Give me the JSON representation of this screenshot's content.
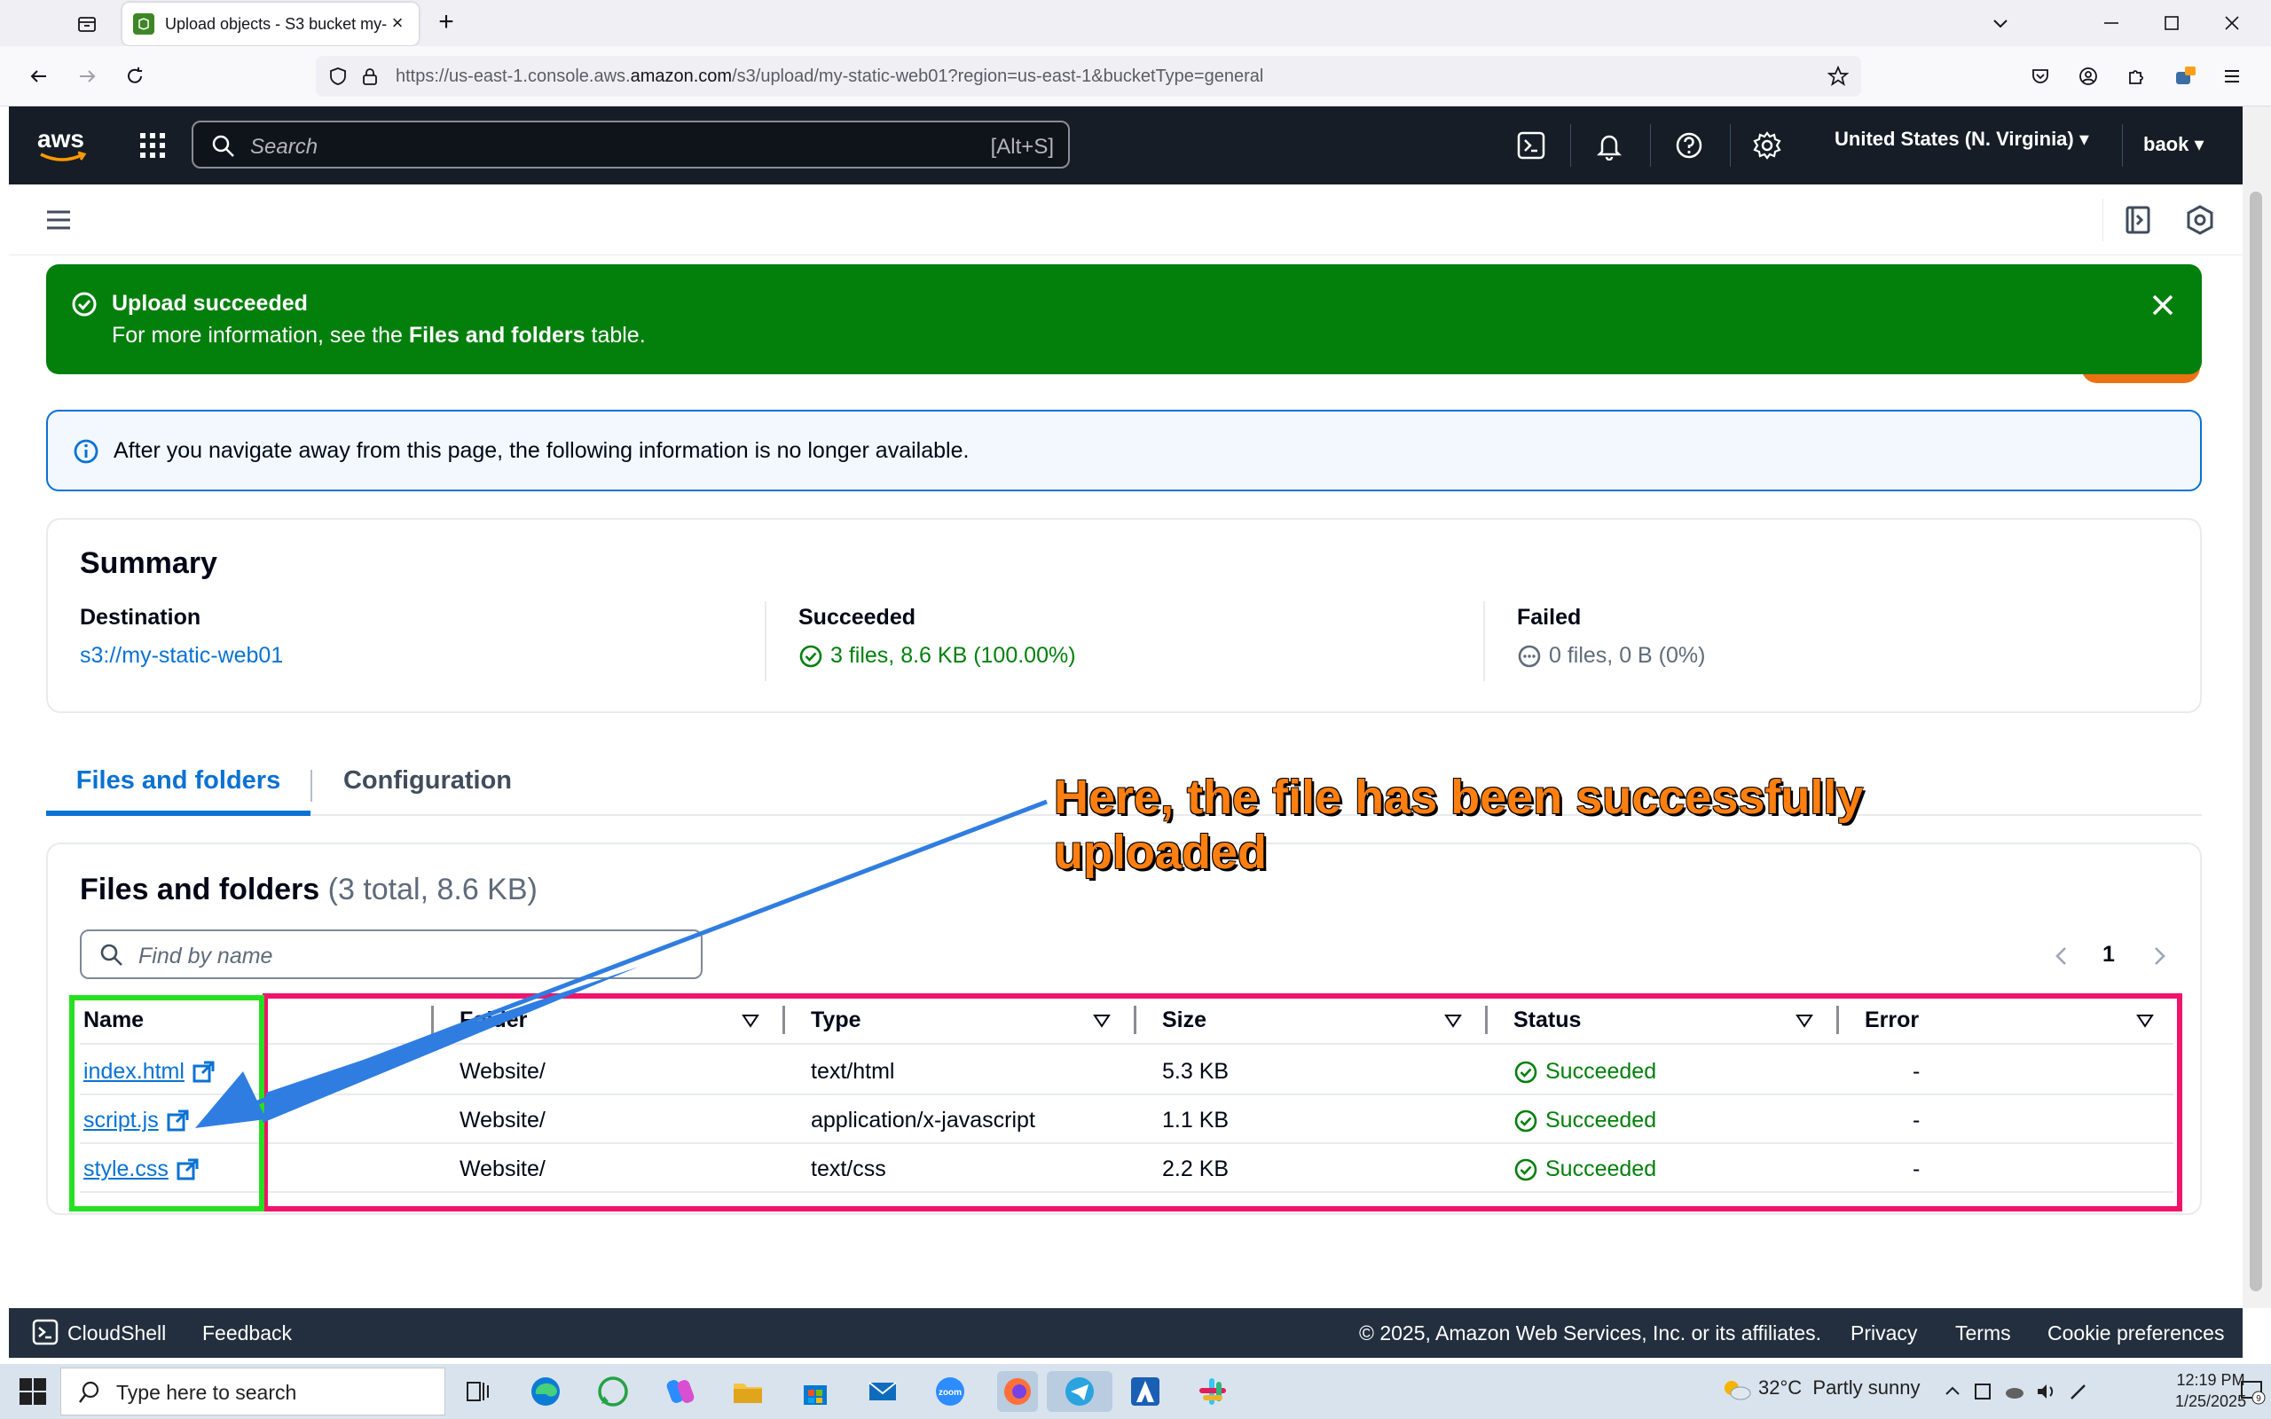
{
  "browser": {
    "tab_title": "Upload objects - S3 bucket my-static-web01",
    "url_prefix": "https://us-east-1.console.aws.",
    "url_domain": "amazon.com",
    "url_suffix": "/s3/upload/my-static-web01?region=us-east-1&bucketType=general"
  },
  "aws_header": {
    "search_placeholder": "Search",
    "search_shortcut": "[Alt+S]",
    "region": "United States (N. Virginia)",
    "user": "baok"
  },
  "flash": {
    "title": "Upload succeeded",
    "message_before": "For more information, see the ",
    "message_bold": "Files and folders",
    "message_after": " table."
  },
  "info": {
    "message": "After you navigate away from this page, the following information is no longer available."
  },
  "summary": {
    "title": "Summary",
    "destination_label": "Destination",
    "destination_value": "s3://my-static-web01",
    "succeeded_label": "Succeeded",
    "succeeded_value": "3 files, 8.6 KB (100.00%)",
    "failed_label": "Failed",
    "failed_value": "0 files, 0 B (0%)"
  },
  "tabs": {
    "files": "Files and folders",
    "config": "Configuration"
  },
  "files_panel": {
    "title": "Files and folders",
    "count": "(3 total, 8.6 KB)",
    "find_placeholder": "Find by name",
    "page": "1",
    "columns": [
      "Name",
      "Folder",
      "Type",
      "Size",
      "Status",
      "Error"
    ],
    "rows": [
      {
        "name": "index.html",
        "folder": "Website/",
        "type": "text/html",
        "size": "5.3 KB",
        "status": "Succeeded",
        "error": "-"
      },
      {
        "name": "script.js",
        "folder": "Website/",
        "type": "application/x-javascript",
        "size": "1.1 KB",
        "status": "Succeeded",
        "error": "-"
      },
      {
        "name": "style.css",
        "folder": "Website/",
        "type": "text/css",
        "size": "2.2 KB",
        "status": "Succeeded",
        "error": "-"
      }
    ]
  },
  "annotation": {
    "line1": "Here, the file has been successfully",
    "line2": "uploaded",
    "colors": {
      "text": "#ff7f10",
      "arrow": "#2f7de1",
      "name_box": "#26e020",
      "table_box": "#f0146a"
    }
  },
  "footer": {
    "cloudshell": "CloudShell",
    "feedback": "Feedback",
    "copyright": "© 2025, Amazon Web Services, Inc. or its affiliates.",
    "privacy": "Privacy",
    "terms": "Terms",
    "cookies": "Cookie preferences"
  },
  "taskbar": {
    "search_placeholder": "Type here to search",
    "weather_temp": "32°C",
    "weather_desc": "Partly sunny",
    "time": "12:19 PM",
    "date": "1/25/2025",
    "notifications": "9"
  },
  "colors": {
    "aws_header": "#161d26",
    "success_green": "#037f0c",
    "link_blue": "#0972d3",
    "info_bg": "#f2f8fd"
  }
}
